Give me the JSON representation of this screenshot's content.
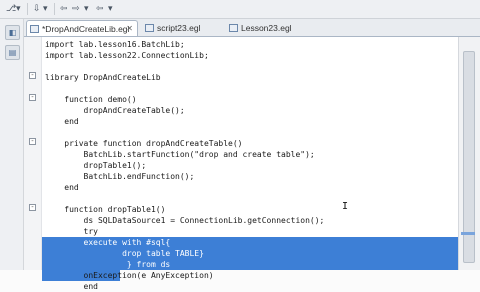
{
  "toolbar": {
    "buttons": [
      "⎇",
      "▾",
      "⇩",
      "▾",
      "⇦",
      "⇨",
      "▾",
      "⇦",
      "▾"
    ]
  },
  "sidebar": {
    "icons": [
      "◧",
      "▤"
    ]
  },
  "tabs": [
    {
      "label": "*DropAndCreateLib.egl",
      "active": true
    },
    {
      "label": "script23.egl",
      "active": false
    },
    {
      "label": "Lesson23.egl",
      "active": false
    }
  ],
  "editor": {
    "lines": [
      {
        "text": "import lab.lesson16.BatchLib;",
        "state": "normal"
      },
      {
        "text": "import lab.lesson22.ConnectionLib;",
        "state": "normal"
      },
      {
        "text": "",
        "state": "normal"
      },
      {
        "text": "library DropAndCreateLib",
        "state": "normal"
      },
      {
        "text": "",
        "state": "normal"
      },
      {
        "text": "    function demo()",
        "state": "normal"
      },
      {
        "text": "        dropAndCreateTable();",
        "state": "normal"
      },
      {
        "text": "    end",
        "state": "normal"
      },
      {
        "text": "",
        "state": "normal"
      },
      {
        "text": "    private function dropAndCreateTable()",
        "state": "normal"
      },
      {
        "text": "        BatchLib.startFunction(\"drop and create table\");",
        "state": "normal"
      },
      {
        "text": "        dropTable1();",
        "state": "normal"
      },
      {
        "text": "        BatchLib.endFunction();",
        "state": "normal"
      },
      {
        "text": "    end",
        "state": "normal"
      },
      {
        "text": "",
        "state": "normal"
      },
      {
        "text": "    function dropTable1()",
        "state": "normal"
      },
      {
        "text": "        ds SQLDataSource1 = ConnectionLib.getConnection();",
        "state": "normal"
      },
      {
        "text": "        try",
        "state": "normal"
      },
      {
        "text": "        execute with #sql{",
        "state": "sel"
      },
      {
        "text": "                drop table TABLE}",
        "state": "sel"
      },
      {
        "text": "                 } from ds",
        "state": "sel"
      },
      {
        "text": "        onException(e AnyException)",
        "state": "sel-partial"
      },
      {
        "text": "        end",
        "state": "normal"
      }
    ]
  }
}
